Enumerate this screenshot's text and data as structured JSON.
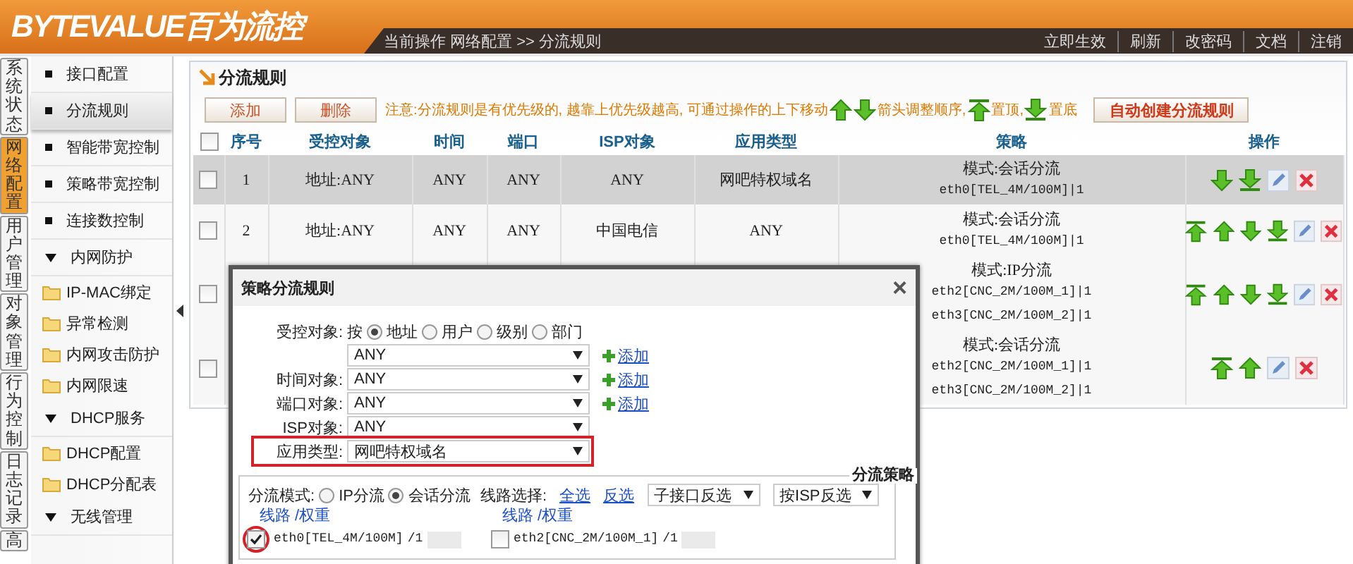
{
  "header": {
    "logo": "BYTEVALUE百为流控",
    "breadcrumb": "当前操作 网络配置 >> 分流规则",
    "links": [
      "立即生效",
      "刷新",
      "改密码",
      "文档",
      "注销"
    ]
  },
  "vertical_tabs": [
    {
      "label": "系统状态",
      "selected": false
    },
    {
      "label": "网络配置",
      "selected": true
    },
    {
      "label": "用户管理",
      "selected": false
    },
    {
      "label": "对象管理",
      "selected": false
    },
    {
      "label": "行为控制",
      "selected": false
    },
    {
      "label": "日志记录",
      "selected": false
    },
    {
      "label": "高",
      "selected": false
    }
  ],
  "sidebar": {
    "items": [
      {
        "kind": "item",
        "label": "接口配置",
        "selected": false
      },
      {
        "kind": "item",
        "label": "分流规则",
        "selected": true
      },
      {
        "kind": "item",
        "label": "智能带宽控制",
        "selected": false
      },
      {
        "kind": "item",
        "label": "策略带宽控制",
        "selected": false
      },
      {
        "kind": "item",
        "label": "连接数控制",
        "selected": false
      },
      {
        "kind": "group",
        "label": "内网防护",
        "expanded": true,
        "children": [
          {
            "label": "IP-MAC绑定"
          },
          {
            "label": "异常检测"
          },
          {
            "label": "内网攻击防护"
          },
          {
            "label": "内网限速"
          }
        ]
      },
      {
        "kind": "group",
        "label": "DHCP服务",
        "expanded": true,
        "children": [
          {
            "label": "DHCP配置"
          },
          {
            "label": "DHCP分配表"
          }
        ]
      },
      {
        "kind": "group",
        "label": "无线管理",
        "expanded": true
      }
    ]
  },
  "panel": {
    "title": "分流规则",
    "buttons": [
      "添加",
      "删除"
    ],
    "notice": [
      {
        "kind": "text",
        "text": "注意:分流规则是有优先级的, 越靠上优先级越高, 可通过操作的上下移动"
      },
      {
        "kind": "up"
      },
      {
        "kind": "down"
      },
      {
        "kind": "text",
        "text": "箭头调整顺序,"
      },
      {
        "kind": "top"
      },
      {
        "kind": "text",
        "text": "置顶,"
      },
      {
        "kind": "bottom"
      },
      {
        "kind": "text",
        "text": "置底"
      }
    ],
    "auto_button": "自动创建分流规则"
  },
  "table": {
    "header_checked": false,
    "columns": [
      "序号",
      "受控对象",
      "时间",
      "端口",
      "ISP对象",
      "应用类型",
      "策略",
      "操作"
    ],
    "rows": [
      {
        "checked": false,
        "selected": true,
        "cells": [
          "1",
          "地址:ANY",
          "ANY",
          "ANY",
          "ANY",
          "网吧特权域名"
        ],
        "policy": {
          "mode": "模式:会话分流",
          "lines": [
            "eth0[TEL_4M/100M]|1"
          ]
        },
        "ops": [
          {
            "kind": "down"
          },
          {
            "kind": "bottom"
          },
          {
            "kind": "edit"
          },
          {
            "kind": "delete"
          }
        ]
      },
      {
        "checked": false,
        "selected": false,
        "cells": [
          "2",
          "地址:ANY",
          "ANY",
          "ANY",
          "中国电信",
          "ANY"
        ],
        "policy": {
          "mode": "模式:会话分流",
          "lines": [
            "eth0[TEL_4M/100M]|1"
          ]
        },
        "ops": [
          {
            "kind": "top"
          },
          {
            "kind": "up"
          },
          {
            "kind": "down"
          },
          {
            "kind": "bottom"
          },
          {
            "kind": "edit"
          },
          {
            "kind": "delete"
          }
        ]
      },
      {
        "checked": false,
        "selected": false,
        "cells": [],
        "policy": {
          "mode": "模式:IP分流",
          "lines": [
            "eth2[CNC_2M/100M_1]|1",
            "eth3[CNC_2M/100M_2]|1"
          ]
        },
        "ops": [
          {
            "kind": "top"
          },
          {
            "kind": "up"
          },
          {
            "kind": "down"
          },
          {
            "kind": "bottom"
          },
          {
            "kind": "edit"
          },
          {
            "kind": "delete"
          }
        ]
      },
      {
        "checked": false,
        "selected": false,
        "cells": [],
        "policy": {
          "mode": "模式:会话分流",
          "lines": [
            "eth2[CNC_2M/100M_1]|1",
            "eth3[CNC_2M/100M_2]|1"
          ]
        },
        "ops": [
          {
            "kind": "top"
          },
          {
            "kind": "up"
          },
          {
            "kind": "edit"
          },
          {
            "kind": "delete"
          }
        ]
      }
    ]
  },
  "modal": {
    "title": "策略分流规则",
    "close": "×",
    "target": {
      "label": "受控对象:",
      "prefix": "按",
      "options": [
        {
          "label": "地址",
          "selected": true
        },
        {
          "label": "用户",
          "selected": false
        },
        {
          "label": "级别",
          "selected": false
        },
        {
          "label": "部门",
          "selected": false
        }
      ]
    },
    "selects": [
      {
        "value": "ANY",
        "add_link": "添加",
        "highlighted": false
      },
      {
        "label": "时间对象:",
        "value": "ANY",
        "add_link": "添加",
        "highlighted": false
      },
      {
        "label": "端口对象:",
        "value": "ANY",
        "add_link": "添加",
        "highlighted": false
      },
      {
        "label": "ISP对象:",
        "value": "ANY",
        "highlighted": false
      },
      {
        "label": "应用类型:",
        "value": "网吧特权域名",
        "highlighted": true
      }
    ],
    "strategy": {
      "legend": "分流策略",
      "mode_label": "分流模式:",
      "modes": [
        {
          "label": "IP分流",
          "selected": false
        },
        {
          "label": "会话分流",
          "selected": true
        }
      ],
      "line_label": "线路选择:",
      "links": [
        "全选",
        "反选"
      ],
      "dropdowns": [
        "子接口反选",
        "按ISP反选"
      ],
      "column_headers": [
        "线路 /权重",
        "线路 /权重"
      ],
      "lines": [
        {
          "name": "eth0[TEL_4M/100M]",
          "weight": "/1",
          "checked": true,
          "highlighted": true
        },
        {
          "name": "eth2[CNC_2M/100M_1]",
          "weight": "/1",
          "checked": false,
          "highlighted": false
        }
      ]
    }
  }
}
